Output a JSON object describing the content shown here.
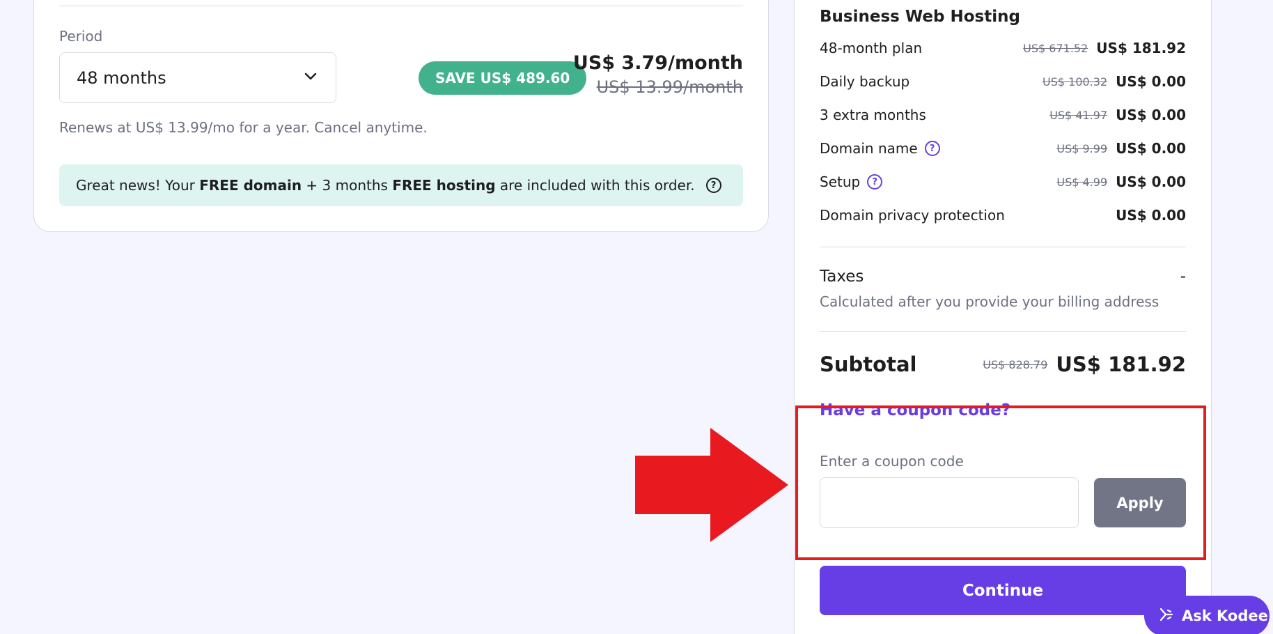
{
  "left": {
    "period_label": "Period",
    "period_value": "48 months",
    "save_badge": "SAVE US$ 489.60",
    "price_now": "US$ 3.79/month",
    "price_old": "US$ 13.99/month",
    "renews": "Renews at US$ 13.99/mo for a year. Cancel anytime.",
    "promo": {
      "p1": "Great news! Your ",
      "b1": "FREE domain",
      "p2": " + 3 months ",
      "b2": "FREE hosting",
      "p3": " are included with this order."
    }
  },
  "summary": {
    "plan_title": "Business Web Hosting",
    "items": [
      {
        "label": "48-month plan",
        "old": "US$ 671.52",
        "amount": "US$ 181.92"
      },
      {
        "label": "Daily backup",
        "old": "US$ 100.32",
        "amount": "US$ 0.00"
      },
      {
        "label": "3 extra months",
        "old": "US$ 41.97",
        "amount": "US$ 0.00"
      },
      {
        "label": "Domain name",
        "old": "US$ 9.99",
        "amount": "US$ 0.00"
      },
      {
        "label": "Setup",
        "old": "US$ 4.99",
        "amount": "US$ 0.00"
      },
      {
        "label": "Domain privacy protection",
        "old": "",
        "amount": "US$ 0.00"
      }
    ],
    "taxes_label": "Taxes",
    "taxes_value": "-",
    "taxes_note": "Calculated after you provide your billing address",
    "subtotal_label": "Subtotal",
    "subtotal_old": "US$ 828.79",
    "subtotal_amount": "US$ 181.92",
    "coupon_link": "Have a coupon code?",
    "coupon_label": "Enter a coupon code",
    "coupon_value": "",
    "apply_label": "Apply",
    "continue_label": "Continue"
  },
  "assistant": {
    "label": "Ask Kodee"
  },
  "colors": {
    "brand": "#673de6",
    "save": "#41b28c",
    "highlight": "#e8191f",
    "promo_bg": "#def4f0"
  }
}
